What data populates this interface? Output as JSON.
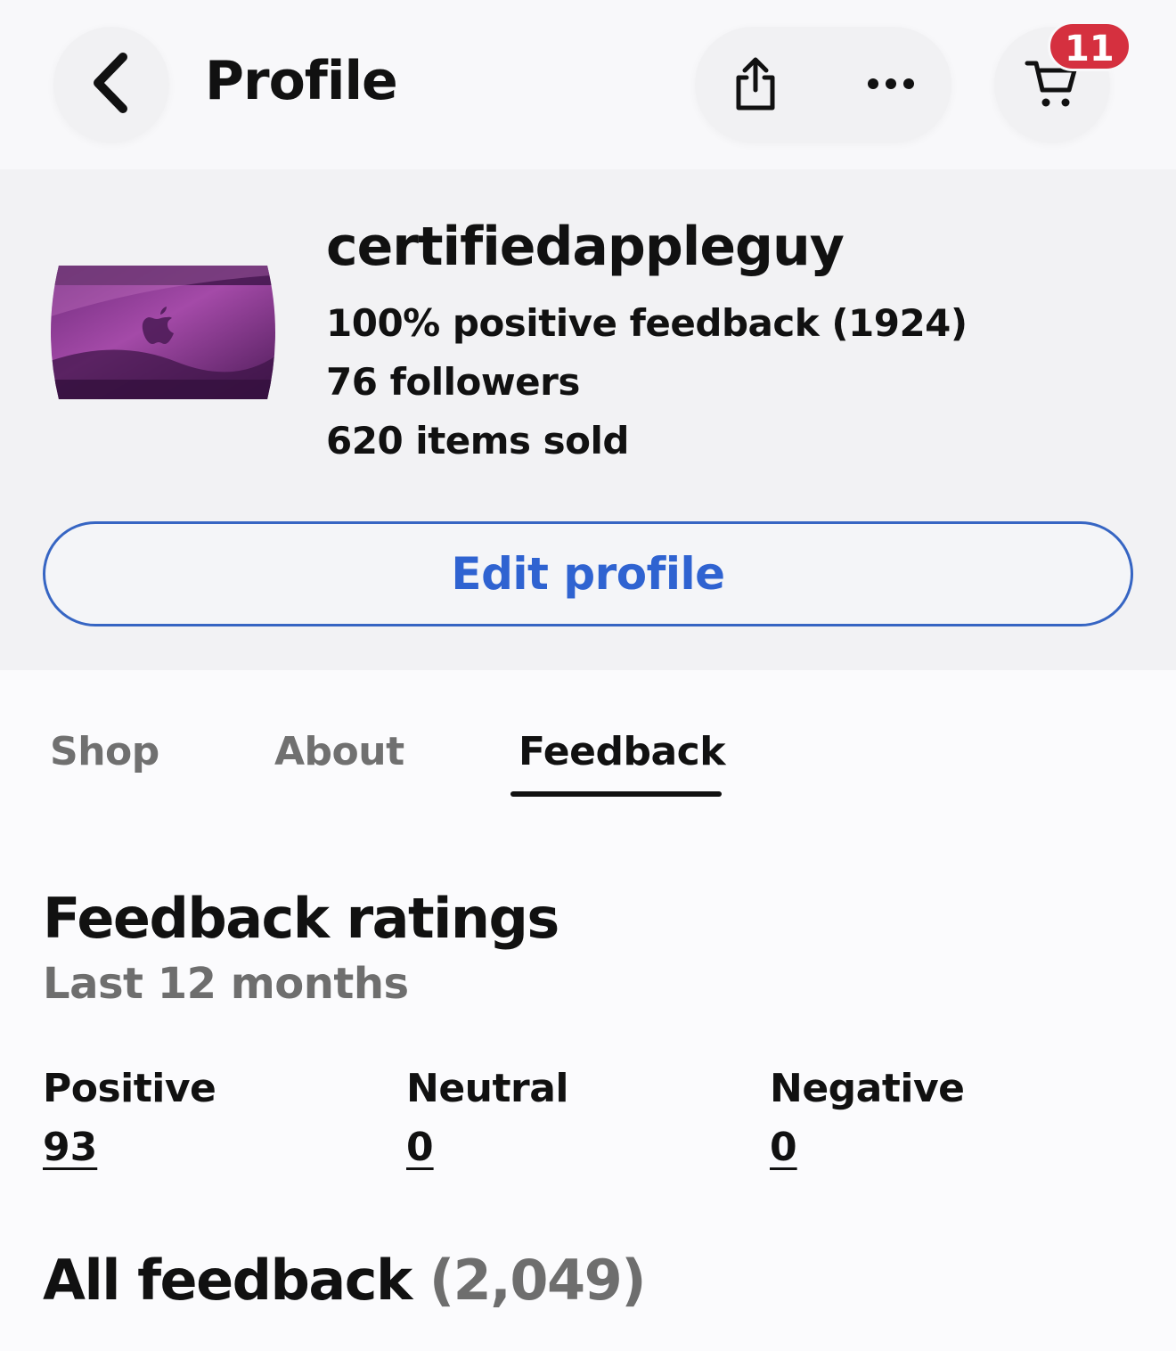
{
  "header": {
    "title": "Profile",
    "cart_count": "11"
  },
  "icons": {
    "back": "chevron-left-icon",
    "share": "share-icon",
    "more": "ellipsis-icon",
    "cart": "cart-icon"
  },
  "profile": {
    "username": "certifiedappleguy",
    "feedback_summary": "100% positive feedback (1924)",
    "followers": "76 followers",
    "items_sold": "620 items sold",
    "edit_label": "Edit profile"
  },
  "tabs": [
    {
      "label": "Shop",
      "active": false
    },
    {
      "label": "About",
      "active": false
    },
    {
      "label": "Feedback",
      "active": true
    }
  ],
  "ratings": {
    "title": "Feedback ratings",
    "period": "Last 12 months",
    "columns": [
      {
        "label": "Positive",
        "value": "93"
      },
      {
        "label": "Neutral",
        "value": "0"
      },
      {
        "label": "Negative",
        "value": "0"
      }
    ]
  },
  "all_feedback": {
    "label": "All feedback",
    "count": "(2,049)"
  },
  "colors": {
    "accent": "#2f63d1",
    "badge": "#d5303f"
  }
}
